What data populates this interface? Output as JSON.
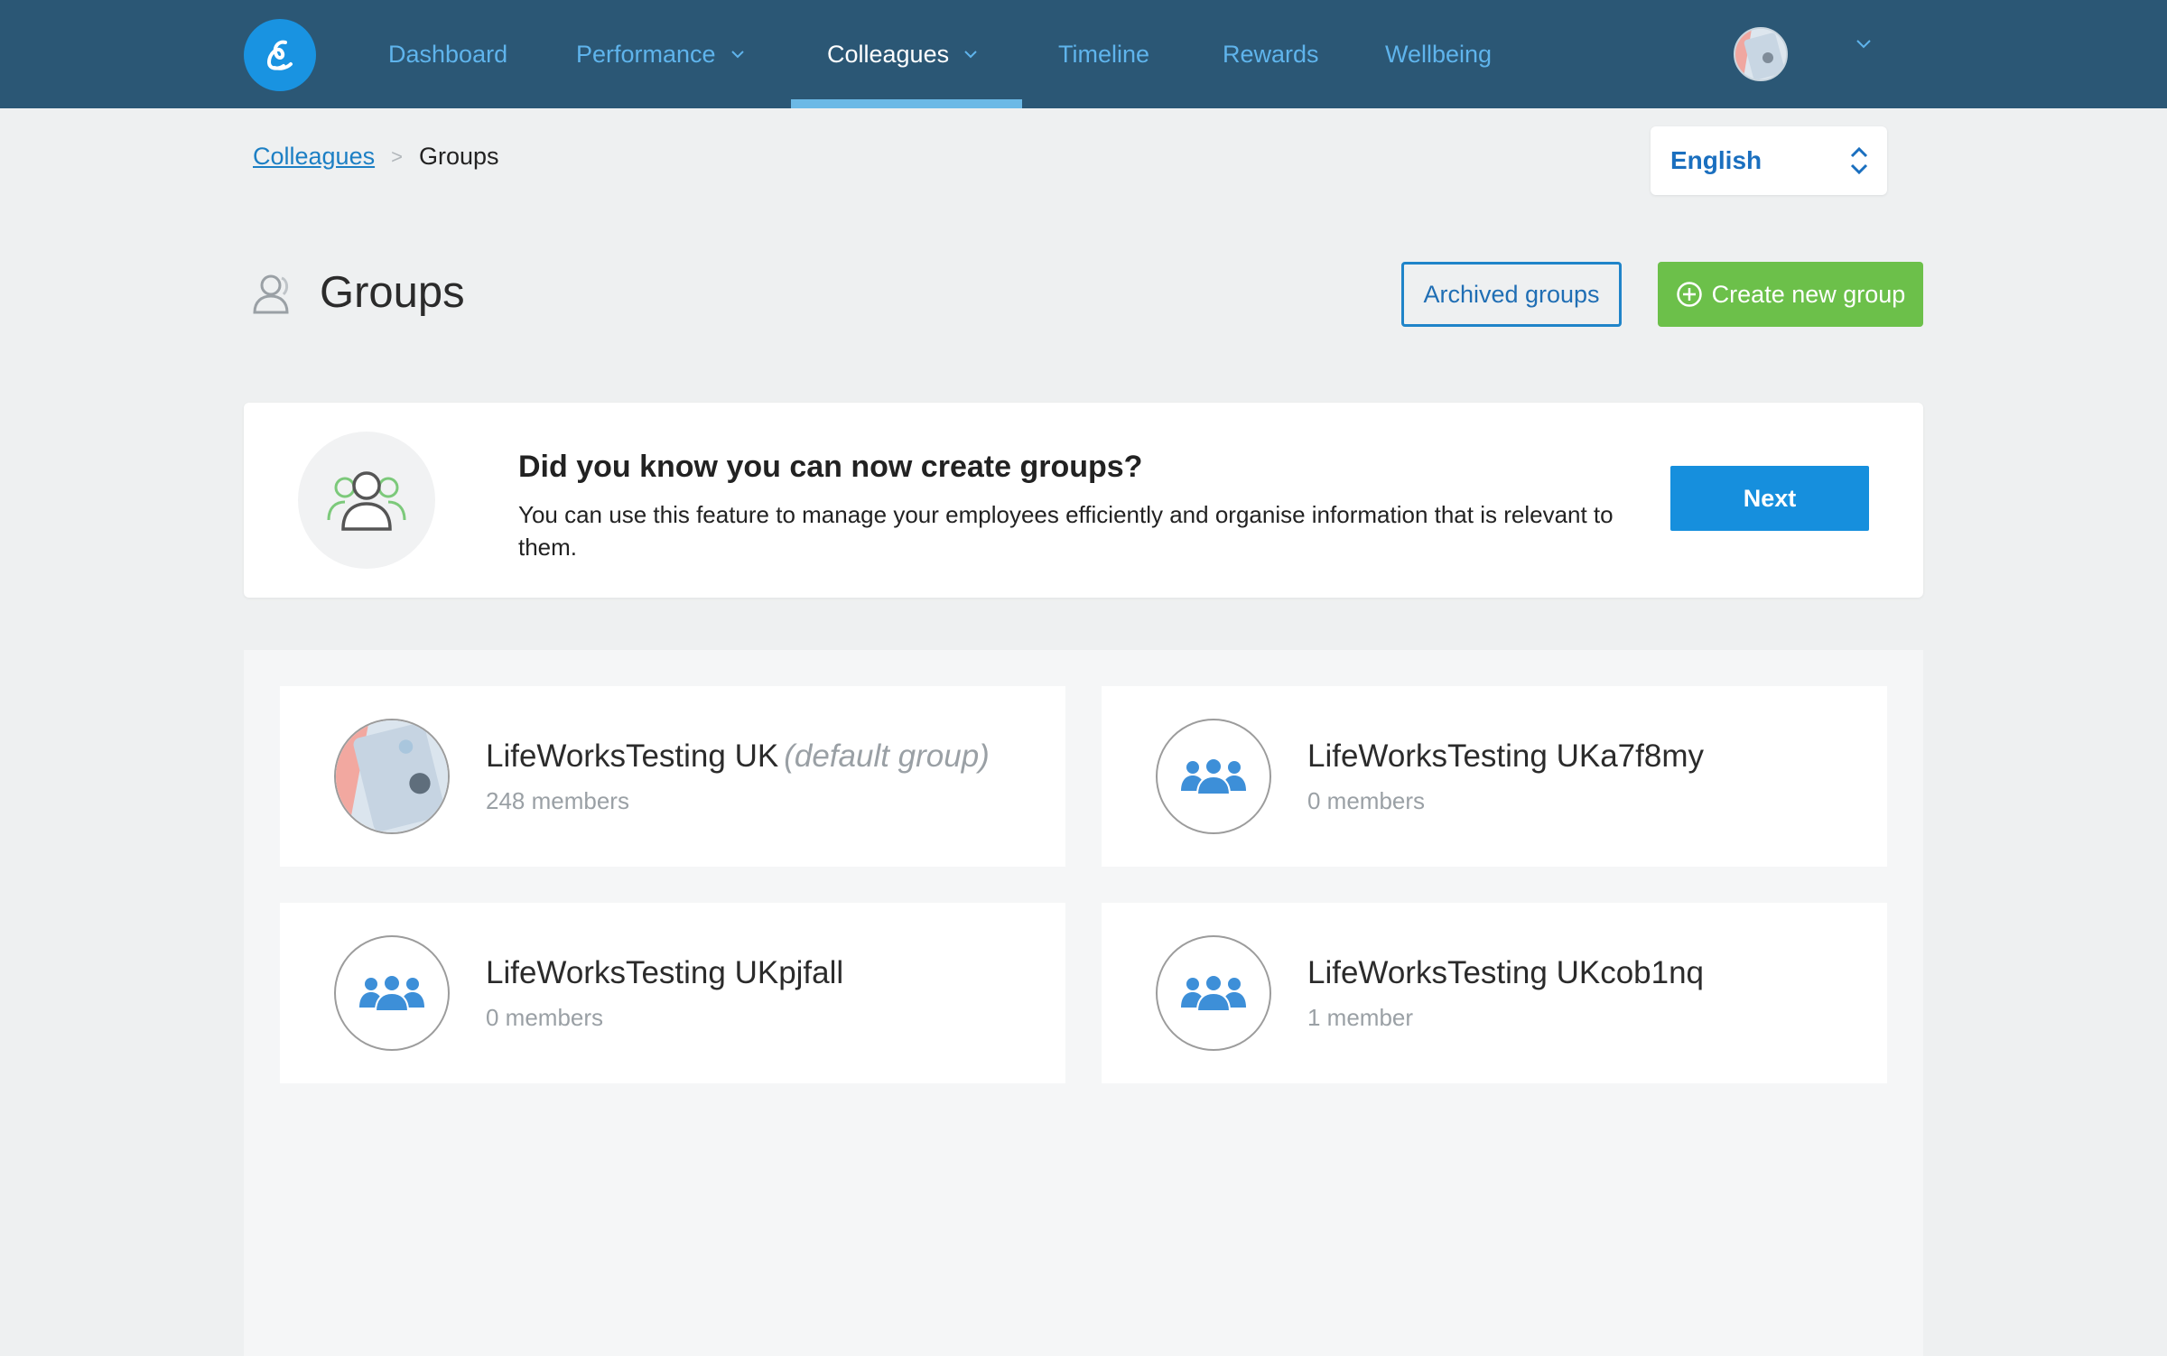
{
  "nav": {
    "items": [
      {
        "label": "Dashboard",
        "has_dropdown": false,
        "active": false
      },
      {
        "label": "Performance",
        "has_dropdown": true,
        "active": false
      },
      {
        "label": "Colleagues",
        "has_dropdown": true,
        "active": true
      },
      {
        "label": "Timeline",
        "has_dropdown": false,
        "active": false
      },
      {
        "label": "Rewards",
        "has_dropdown": false,
        "active": false
      },
      {
        "label": "Wellbeing",
        "has_dropdown": false,
        "active": false
      }
    ]
  },
  "breadcrumb": {
    "parent": "Colleagues",
    "separator": ">",
    "current": "Groups"
  },
  "language": {
    "selected": "English"
  },
  "page": {
    "title": "Groups",
    "archived_button": "Archived groups",
    "create_button": "Create new group"
  },
  "info_card": {
    "title": "Did you know you can now create groups?",
    "text": "You can use this feature to manage your employees efficiently and organise information that is relevant to them.",
    "next_button": "Next"
  },
  "groups": [
    {
      "name": "LifeWorksTesting UK",
      "tag": "(default group)",
      "members": "248 members",
      "avatar": "photo"
    },
    {
      "name": "LifeWorksTesting UKa7f8my",
      "tag": "",
      "members": "0 members",
      "avatar": "group-icon"
    },
    {
      "name": "LifeWorksTesting UKpjfall",
      "tag": "",
      "members": "0 members",
      "avatar": "group-icon"
    },
    {
      "name": "LifeWorksTesting UKcob1nq",
      "tag": "",
      "members": "1 member",
      "avatar": "group-icon"
    }
  ],
  "colors": {
    "nav_bg": "#2b5775",
    "nav_link": "#5fb4ec",
    "primary": "#168fdd",
    "success": "#6cc04a",
    "group_icon": "#3d8fd8"
  }
}
